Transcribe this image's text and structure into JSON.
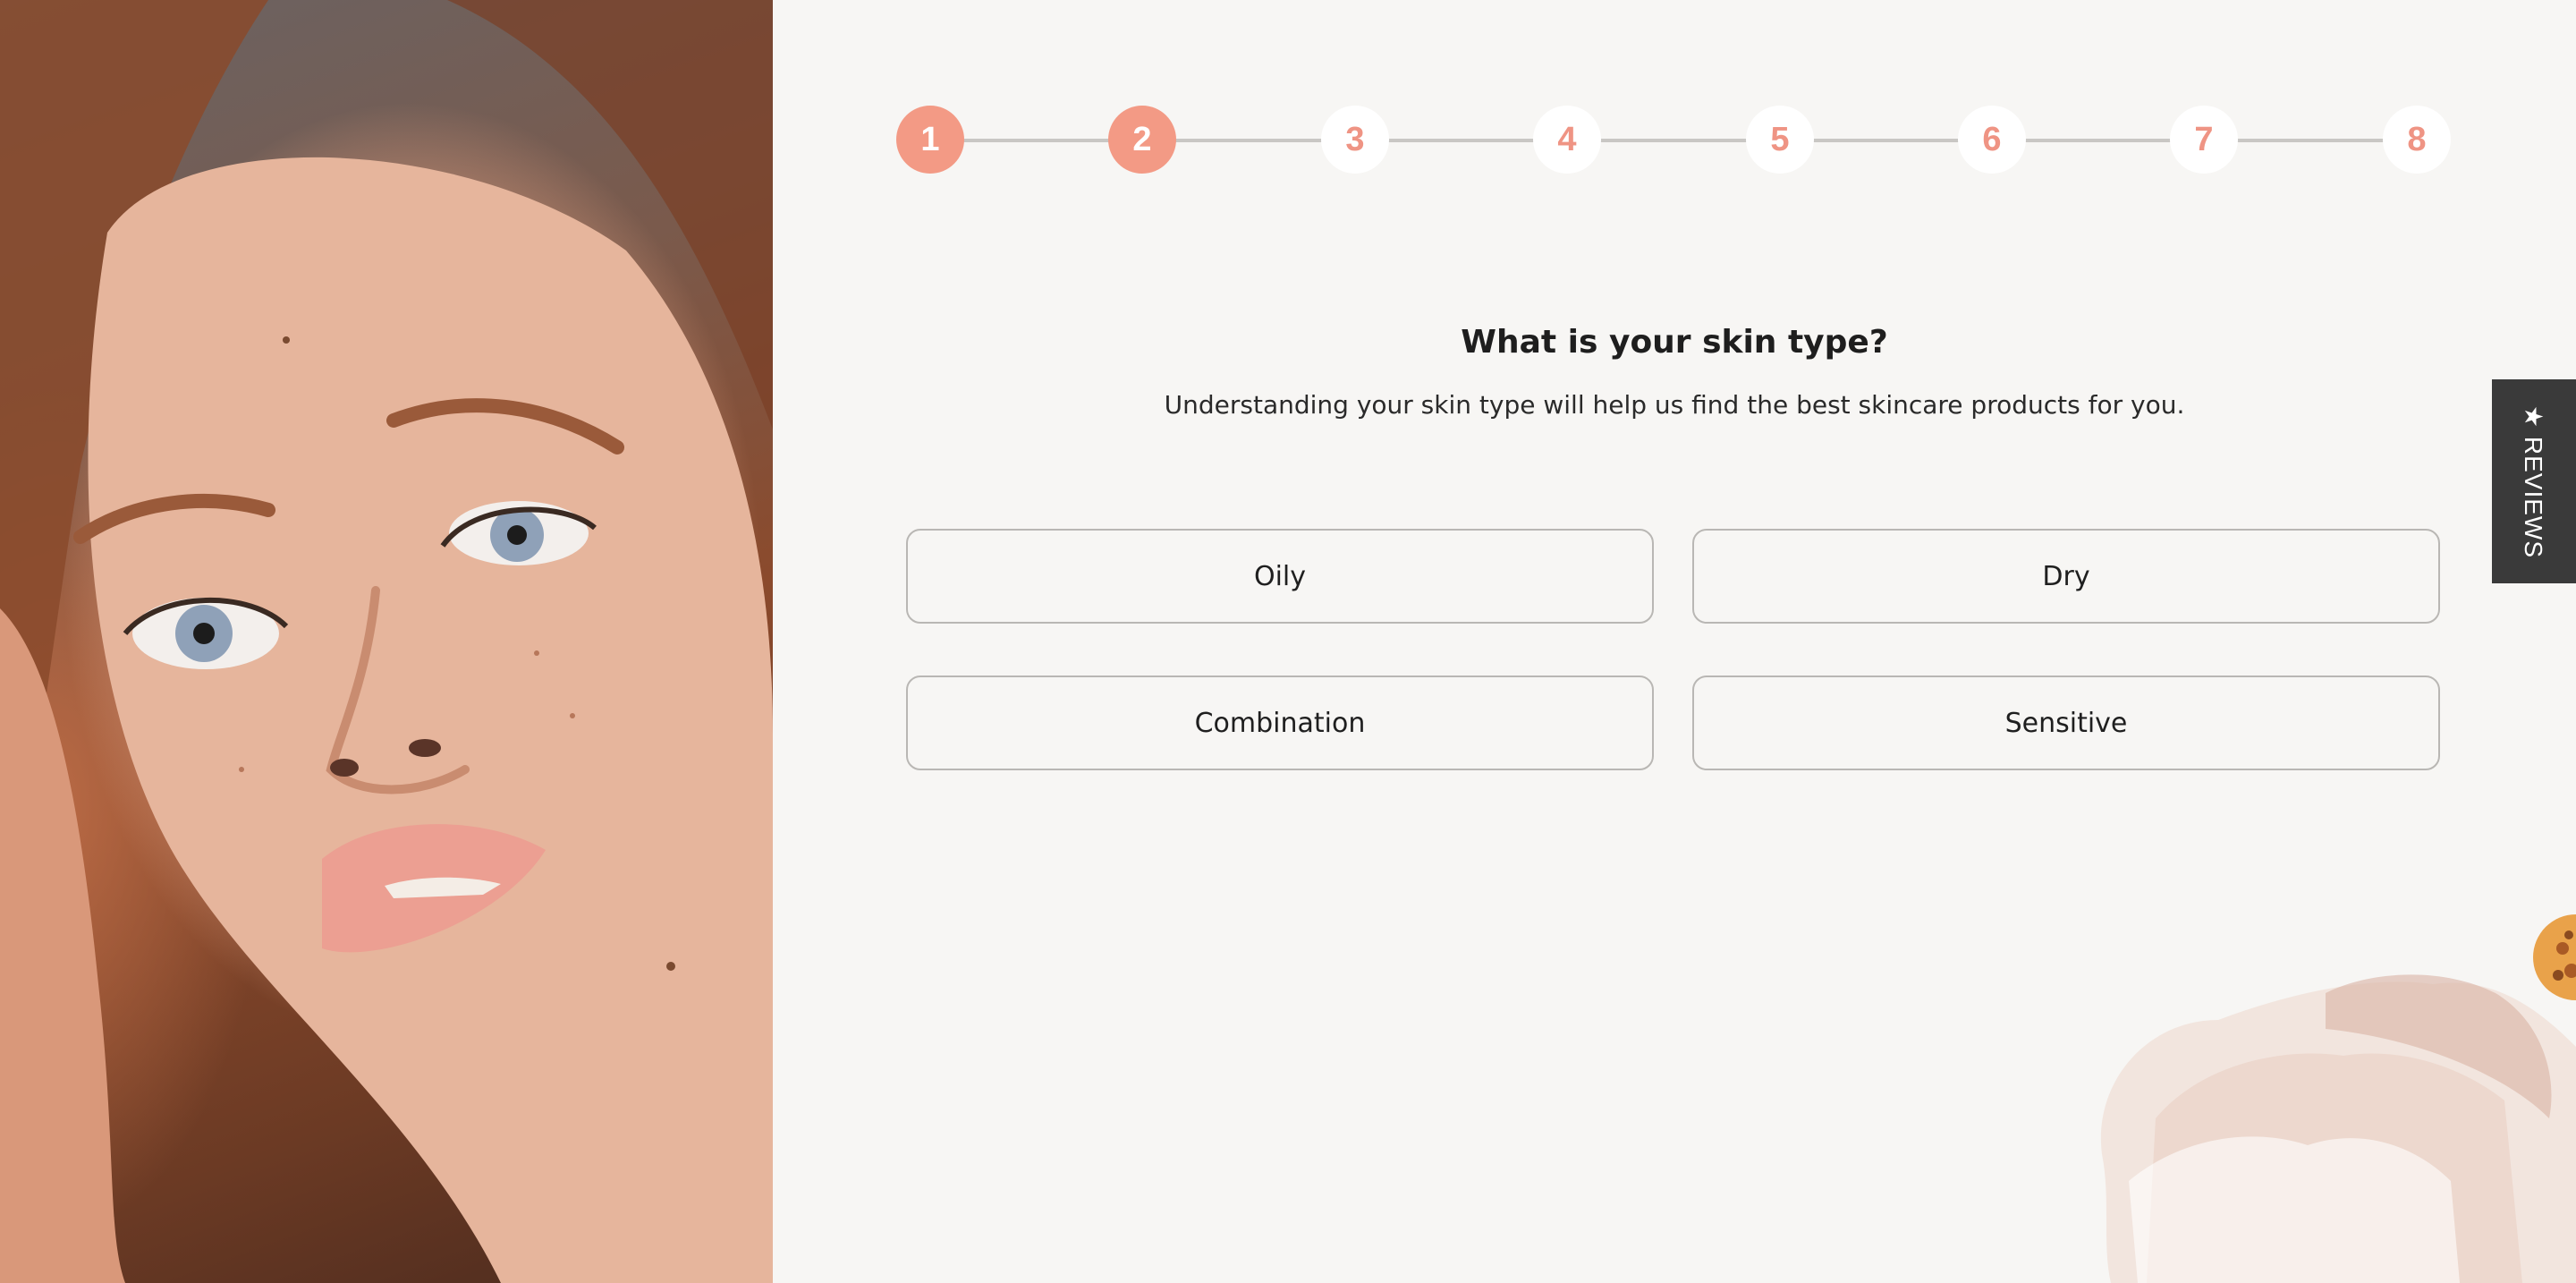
{
  "stepper": {
    "steps": [
      "1",
      "2",
      "3",
      "4",
      "5",
      "6",
      "7",
      "8"
    ],
    "active_steps": [
      1,
      2
    ]
  },
  "question": {
    "title": "What is your skin type?",
    "subtitle": "Understanding your skin type will help us find the best skincare products for you."
  },
  "options": [
    "Oily",
    "Dry",
    "Combination",
    "Sensitive"
  ],
  "reviews_tab": {
    "star": "★",
    "label": "REVIEWS"
  },
  "colors": {
    "accent": "#f39a85",
    "accent_text": "#ef9484",
    "background": "#f7f6f4",
    "reviews_tab": "#3a3a3a",
    "option_border": "#b9b7b4"
  },
  "icons": {
    "reviews_star": "star-icon",
    "hero_image": "woman-face-photo",
    "decoration": "watercolor-brush-decoration"
  }
}
